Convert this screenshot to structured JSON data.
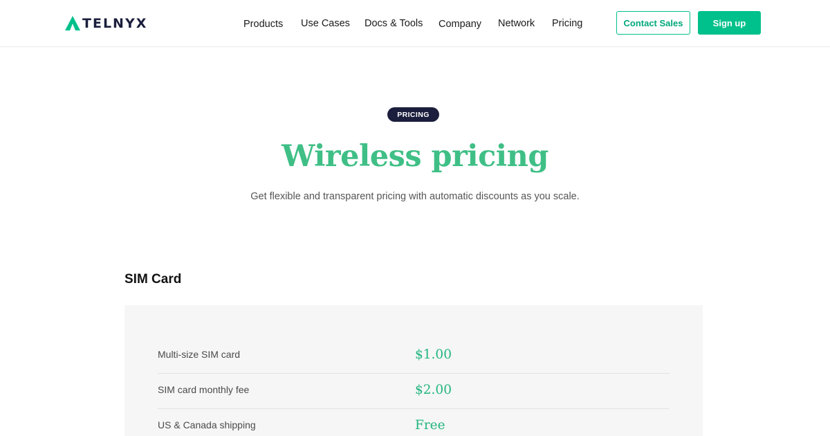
{
  "header": {
    "logo_text": "TELNYX",
    "brand_color": "#00c08b",
    "nav": [
      "Products",
      "Use Cases",
      "Docs & Tools",
      "Company",
      "Network",
      "Pricing"
    ],
    "contact_label": "Contact Sales",
    "signup_label": "Sign up"
  },
  "hero": {
    "badge": "PRICING",
    "title": "Wireless pricing",
    "subtitle": "Get flexible and transparent pricing with automatic discounts as you scale."
  },
  "sim_section": {
    "title": "SIM Card",
    "rows": [
      {
        "label": "Multi-size SIM card",
        "value": "$1.00"
      },
      {
        "label": "SIM card monthly fee",
        "value": "$2.00"
      },
      {
        "label": "US & Canada shipping",
        "value": "Free"
      }
    ]
  }
}
